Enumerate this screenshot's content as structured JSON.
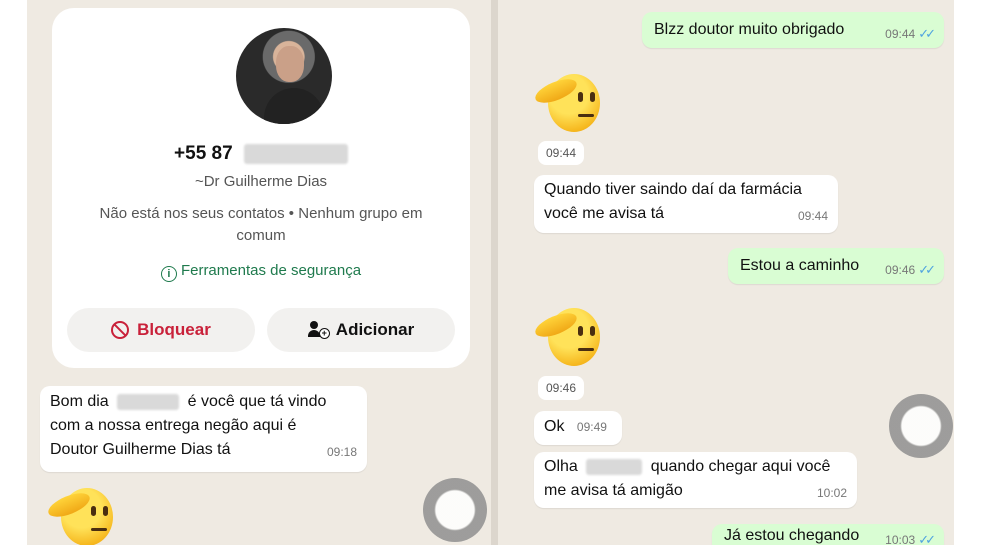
{
  "contact": {
    "phone_prefix": "+55 87",
    "name": "~Dr Guilherme Dias",
    "info": "Não está nos seus contatos • Nenhum grupo em comum",
    "security_label": "Ferramentas de segurança",
    "block_label": "Bloquear",
    "add_label": "Adicionar"
  },
  "left_messages": [
    {
      "line1_pre": "Bom dia",
      "line1_post": "é você que tá vindo",
      "line2": "com a nossa entrega negão aqui é",
      "line3": "Doutor Guilherme Dias tá",
      "time": "09:18"
    }
  ],
  "right_messages": {
    "m1": {
      "text": "Blzz doutor muito obrigado",
      "time": "09:44"
    },
    "sticker1_time": "09:44",
    "m2": {
      "line1": "Quando tiver saindo daí da farmácia",
      "line2": "você me avisa tá",
      "time": "09:44"
    },
    "m3": {
      "text": "Estou a caminho",
      "time": "09:46"
    },
    "sticker2_time": "09:46",
    "m4": {
      "text": "Ok",
      "time": "09:49"
    },
    "m5": {
      "line1_pre": "Olha",
      "line1_post": "quando chegar aqui você",
      "line2": "me avisa tá amigão",
      "time": "10:02"
    },
    "m6": {
      "text": "Já estou chegando",
      "time": "10:03"
    }
  },
  "icons": [
    "info-icon",
    "block-icon",
    "add-user-icon",
    "read-ticks-icon",
    "salute-emoji-sticker"
  ],
  "colors": {
    "outgoing": "#d9fdd3",
    "incoming": "#ffffff",
    "chat_bg": "#efeae2",
    "accent_green": "#1f7a4d",
    "danger": "#c9213a",
    "read_ticks": "#4fa3e0"
  }
}
